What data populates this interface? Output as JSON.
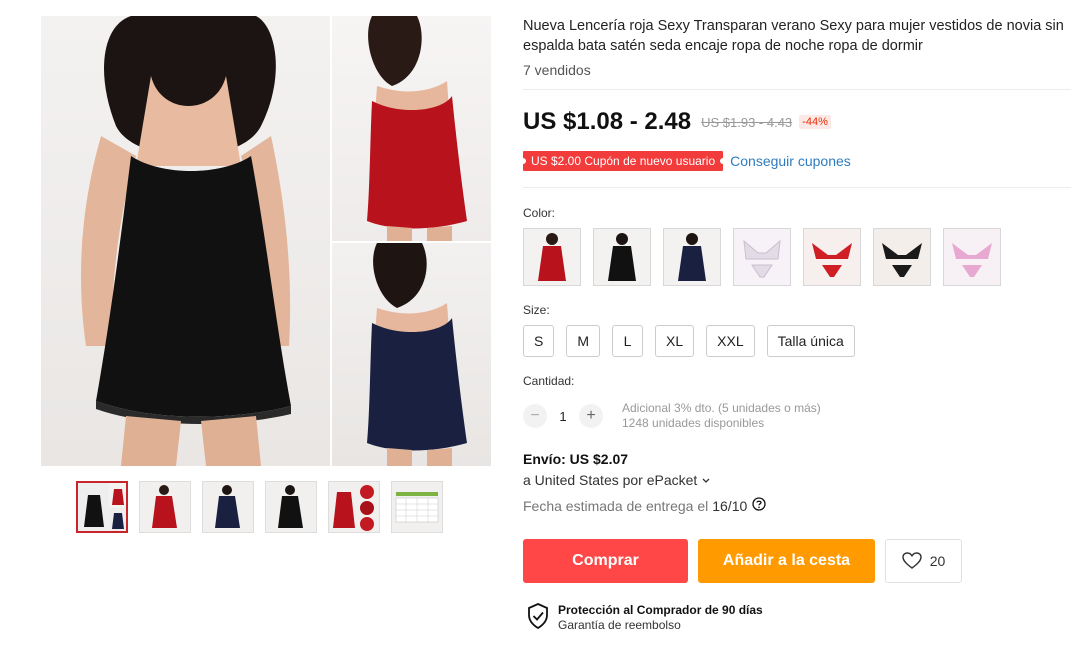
{
  "product": {
    "title": "Nueva Lencería roja Sexy Transparan verano Sexy para mujer vestidos de novia sin espalda bata satén seda encaje ropa de noche ropa de dormir",
    "sold": "7 vendidos"
  },
  "price": {
    "current": "US $1.08 - 2.48",
    "original": "US $1.93 - 4.43",
    "discount": "-44%"
  },
  "coupon": {
    "label": "US $2.00 Cupón de nuevo usuario",
    "link": "Conseguir cupones"
  },
  "color": {
    "label": "Color:",
    "options": [
      {
        "name": "red-dress",
        "color": "#b8121c"
      },
      {
        "name": "black-dress",
        "color": "#111111"
      },
      {
        "name": "navy-dress",
        "color": "#1a2140"
      },
      {
        "name": "white-lace-set",
        "color": "#e8e2ea"
      },
      {
        "name": "red-lace-set",
        "color": "#cf1f24"
      },
      {
        "name": "black-lace-set",
        "color": "#1a1a1a"
      },
      {
        "name": "pink-lace-set",
        "color": "#e7a9d2"
      }
    ]
  },
  "size": {
    "label": "Size:",
    "options": [
      "S",
      "M",
      "L",
      "XL",
      "XXL",
      "Talla única"
    ]
  },
  "quantity": {
    "label": "Cantidad:",
    "value": "1",
    "minus": "−",
    "plus": "+",
    "note_discount": "Adicional 3% dto. (5 unidades o más)",
    "note_stock": "1248 unidades disponibles"
  },
  "shipping": {
    "title": "Envío: US $2.07",
    "route": "a United States por ePacket",
    "date_label": "Fecha estimada de entrega el",
    "date": "16/10"
  },
  "actions": {
    "buy": "Comprar",
    "cart": "Añadir a la cesta",
    "wishlist_count": "20"
  },
  "protection": {
    "title": "Protección al Comprador de 90 días",
    "subtitle": "Garantía de reembolso"
  },
  "gallery": {
    "thumbnails": [
      "collage",
      "red-dress",
      "navy-dress",
      "black-dress",
      "red-detail",
      "size-chart"
    ],
    "active_index": 0
  },
  "colors": {
    "accent_red": "#ff4747",
    "accent_orange": "#ff9a00",
    "coupon_red": "#f23b3b",
    "link_blue": "#2e7cbf"
  }
}
